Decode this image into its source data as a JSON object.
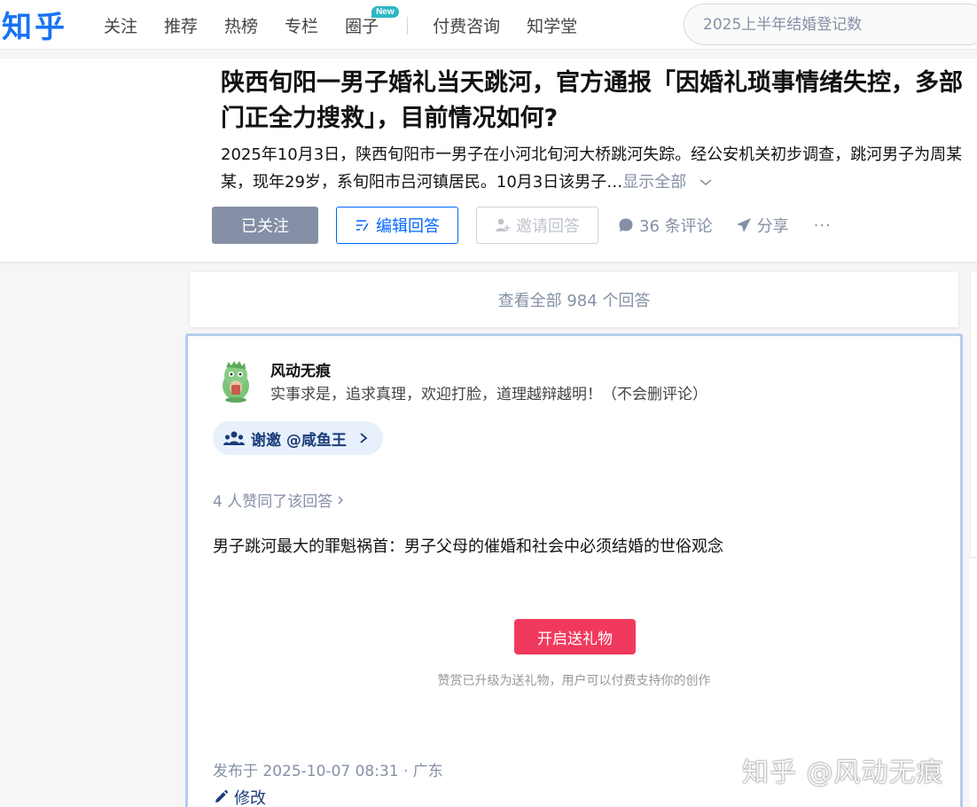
{
  "nav": {
    "logo": "知乎",
    "links": [
      "关注",
      "推荐",
      "热榜",
      "专栏",
      "圈子",
      "付费咨询",
      "知学堂"
    ],
    "new_badge": "New",
    "search_placeholder": "2025上半年结婚登记数"
  },
  "question": {
    "title": "陕西旬阳一男子婚礼当天跳河，官方通报「因婚礼琐事情绪失控，多部门正全力搜救」，目前情况如何?",
    "detail": "2025年10月3日，陕西旬阳市一男子在小河北旬河大桥跳河失踪。经公安机关初步调查，跳河男子为周某某，现年29岁，系旬阳市吕河镇居民。10月3日该男子…",
    "show_all": "显示全部",
    "actions": {
      "followed": "已关注",
      "edit_answer": "编辑回答",
      "invite": "邀请回答",
      "comments": "36 条评论",
      "share": "分享",
      "more": "···"
    }
  },
  "view_all": "查看全部 984 个回答",
  "answer": {
    "author_name": "风动无痕",
    "author_bio": "实事求是，追求真理，欢迎打脸，道理越辩越明！（不会删评论）",
    "thanks": "谢邀 @咸鱼王",
    "likes": "4 人赞同了该回答",
    "content": "男子跳河最大的罪魁祸首：男子父母的催婚和社会中必须结婚的世俗观念",
    "gift_button": "开启送礼物",
    "gift_note": "赞赏已升级为送礼物，用户可以付费支持你的创作",
    "published": "发布于 2025-10-07 08:31 · 广东",
    "edit": "修改"
  },
  "watermark": "知乎 @风动无痕",
  "colors": {
    "brand_blue": "#1772f6",
    "gift_red": "#f1395d",
    "muted": "#8590a6",
    "followed_bg": "#8590a6",
    "answer_border": "#b4cdee"
  }
}
